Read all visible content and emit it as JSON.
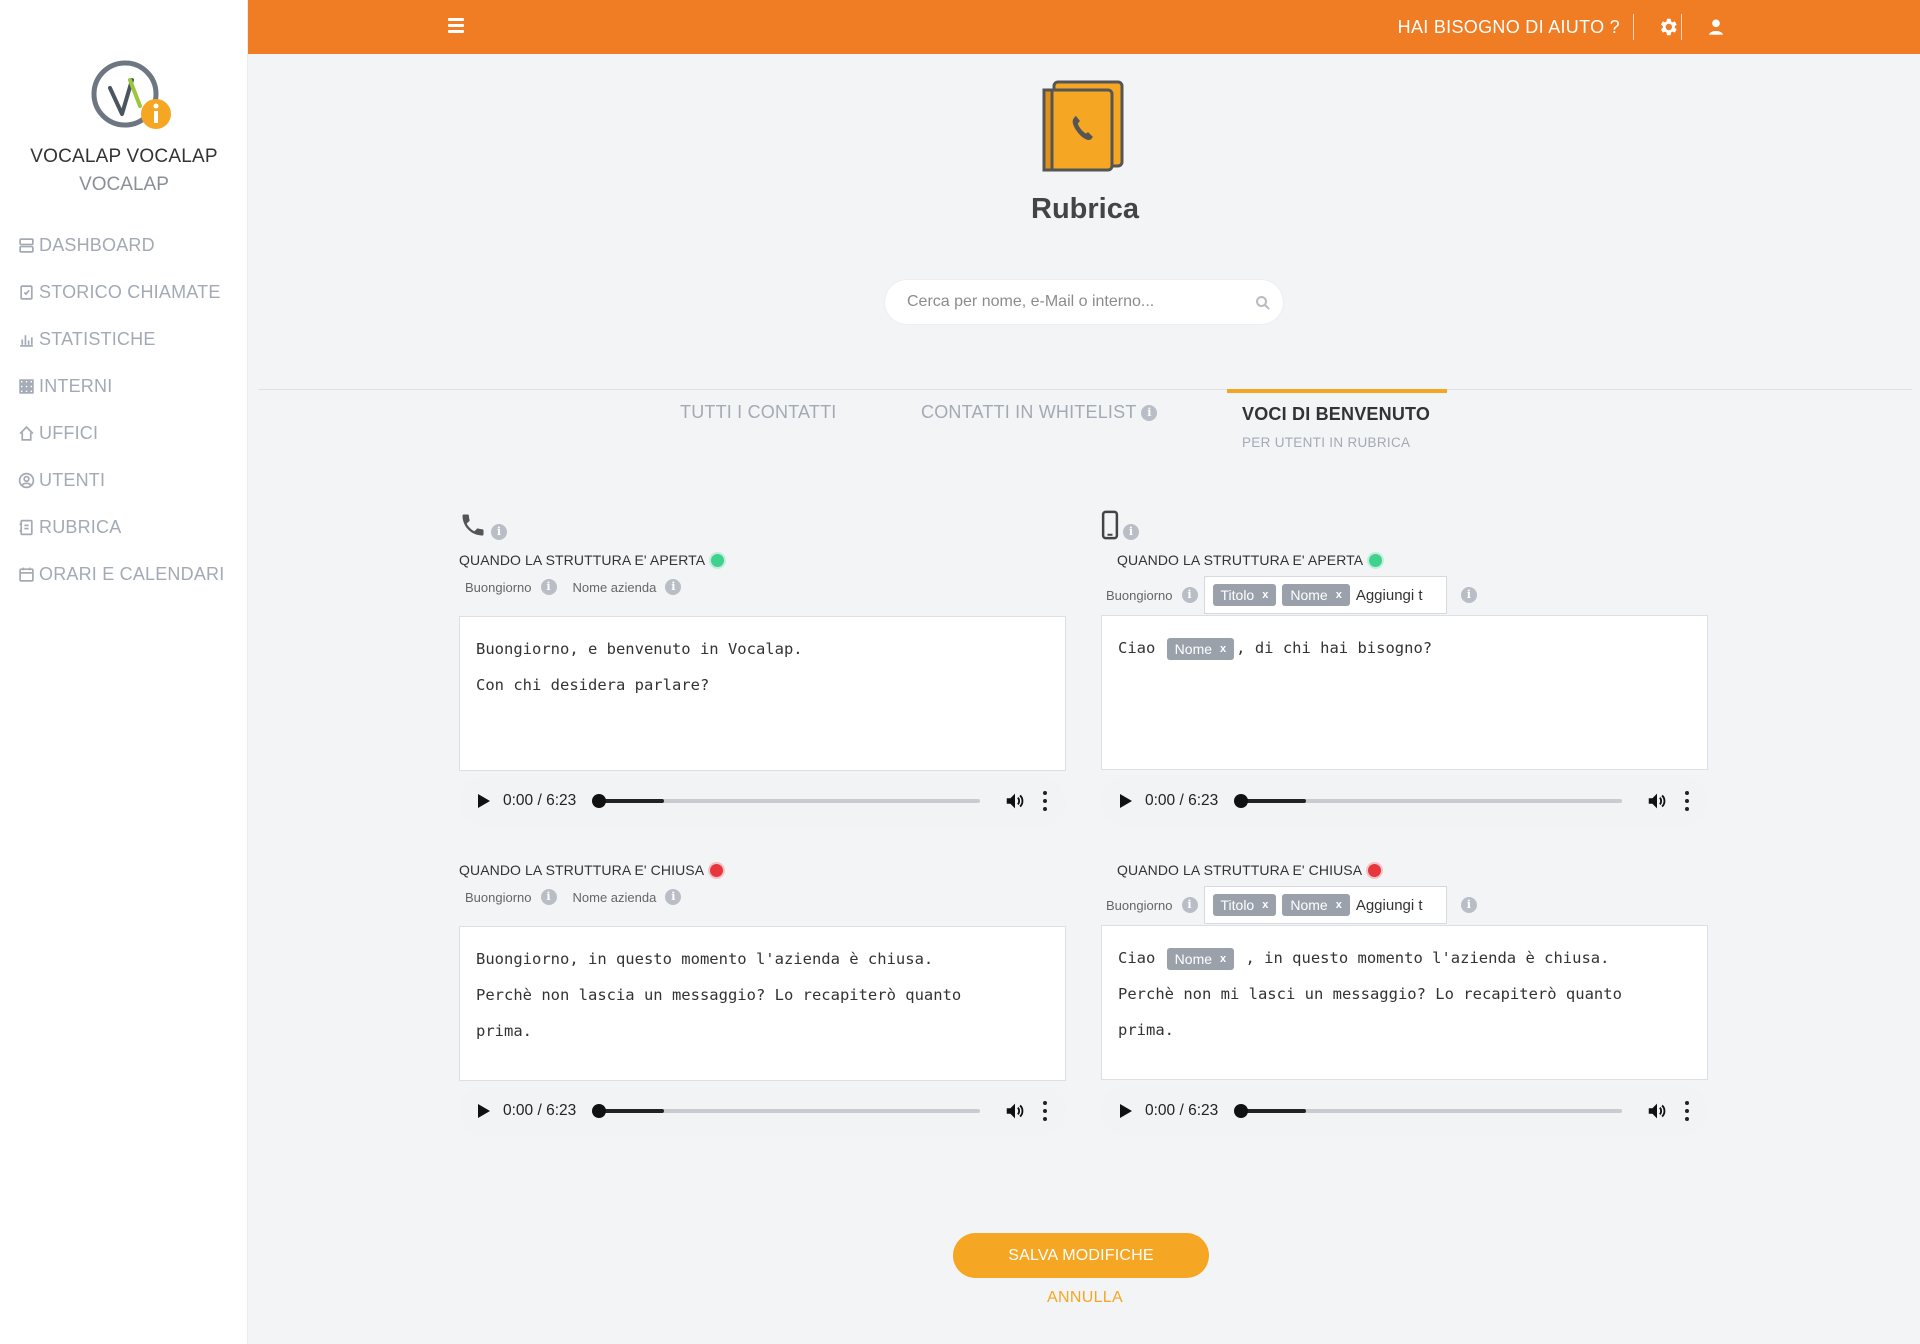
{
  "sidebar": {
    "user_name": "VOCALAP VOCALAP",
    "user_sub": "VOCALAP",
    "items": [
      {
        "label": "DASHBOARD",
        "icon": "dashboard-icon"
      },
      {
        "label": "STORICO CHIAMATE",
        "icon": "clipboard-icon"
      },
      {
        "label": "STATISTICHE",
        "icon": "bar-chart-icon"
      },
      {
        "label": "INTERNI",
        "icon": "grid-icon"
      },
      {
        "label": "UFFICI",
        "icon": "home-icon"
      },
      {
        "label": "UTENTI",
        "icon": "user-circle-icon"
      },
      {
        "label": "RUBRICA",
        "icon": "address-book-icon"
      },
      {
        "label": "ORARI E CALENDARI",
        "icon": "calendar-icon"
      }
    ]
  },
  "topbar": {
    "help_label": "HAI BISOGNO DI AIUTO ?",
    "accent": "#f07c23"
  },
  "header": {
    "title": "Rubrica",
    "search_placeholder": "Cerca per nome, e-Mail o interno..."
  },
  "tabs": {
    "all_contacts": "TUTTI I CONTATTI",
    "whitelist": "CONTATTI IN WHITELIST",
    "welcome": "VOCI DI BENVENUTO",
    "welcome_sub": "PER UTENTI IN RUBRICA"
  },
  "panels": {
    "landline": {
      "icon": "phone-icon",
      "open": {
        "label": "QUANDO LA STRUTTURA E' APERTA",
        "vars": [
          "Buongiorno",
          "Nome azienda"
        ],
        "lines": [
          "Buongiorno, e benvenuto in Vocalap.",
          "Con chi desidera parlare?"
        ],
        "audio_time": "0:00 / 6:23"
      },
      "closed": {
        "label": "QUANDO LA STRUTTURA E' CHIUSA",
        "vars": [
          "Buongiorno",
          "Nome azienda"
        ],
        "lines": [
          "Buongiorno, in questo momento l'azienda è chiusa.",
          "Perchè non lascia un messaggio? Lo recapiterò quanto",
          "prima."
        ],
        "audio_time": "0:00 / 6:23"
      }
    },
    "mobile": {
      "icon": "mobile-icon",
      "open": {
        "label": "QUANDO LA STRUTTURA E' APERTA",
        "var": "Buongiorno",
        "tags": [
          "Titolo",
          "Nome"
        ],
        "tag_input_value": "Aggiungi t",
        "text_before": "Ciao",
        "text_tag": "Nome",
        "text_after": ", di chi hai bisogno?",
        "audio_time": "0:00 / 6:23"
      },
      "closed": {
        "label": "QUANDO LA STRUTTURA E' CHIUSA",
        "var": "Buongiorno",
        "tags": [
          "Titolo",
          "Nome"
        ],
        "tag_input_value": "Aggiungi t",
        "text_before": "Ciao",
        "text_tag": "Nome",
        "text_after": ", in questo momento l'azienda è chiusa.",
        "lines": [
          "Perchè non mi lasci un messaggio? Lo recapiterò quanto",
          "prima."
        ],
        "audio_time": "0:00 / 6:23"
      }
    }
  },
  "actions": {
    "save": "SALVA MODIFICHE",
    "cancel": "ANNULLA"
  },
  "audio_progress_fraction": 0.0
}
